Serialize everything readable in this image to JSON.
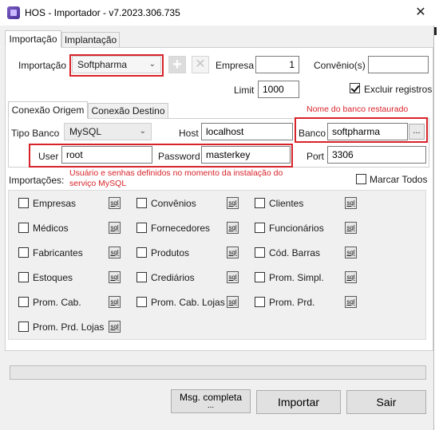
{
  "window": {
    "title": "HOS - Importador - v7.2023.306.735",
    "close_glyph": "✕"
  },
  "tabs": [
    {
      "label": "Importação",
      "active": true
    },
    {
      "label": "Implantação",
      "active": false
    }
  ],
  "import_row": {
    "importacao_label": "Importação",
    "importacao_value": "Softpharma",
    "add_glyph": "+",
    "remove_glyph": "✕",
    "empresa_label": "Empresa",
    "empresa_value": "1",
    "convenio_label": "Convênio(s)",
    "convenio_value": "",
    "limit_label": "Limit",
    "limit_value": "1000",
    "excluir_label": "Excluir registros",
    "excluir_checked": true
  },
  "conn_tabs": [
    {
      "label": "Conexão Origem",
      "active": true
    },
    {
      "label": "Conexão Destino",
      "active": false
    }
  ],
  "notes": {
    "banco_note": "Nome do banco restaurado",
    "user_note_line1": "Usuário e senhas definidos no momento da instalação do",
    "user_note_line2": "serviço MySQL"
  },
  "connection": {
    "tipo_banco_label": "Tipo Banco",
    "tipo_banco_value": "MySQL",
    "host_label": "Host",
    "host_value": "localhost",
    "banco_label": "Banco",
    "banco_value": "softpharma",
    "browse_glyph": "...",
    "user_label": "User",
    "user_value": "root",
    "password_label": "Password",
    "password_value": "masterkey",
    "port_label": "Port",
    "port_value": "3306"
  },
  "importacoes": {
    "label": "Importações:",
    "marcar_todos": "Marcar Todos",
    "sql_label": "sql",
    "items": [
      {
        "label": "Empresas"
      },
      {
        "label": "Convênios"
      },
      {
        "label": "Clientes"
      },
      {
        "label": "Médicos"
      },
      {
        "label": "Fornecedores"
      },
      {
        "label": "Funcionários"
      },
      {
        "label": "Fabricantes"
      },
      {
        "label": "Produtos"
      },
      {
        "label": "Cód. Barras"
      },
      {
        "label": "Estoques"
      },
      {
        "label": "Crediários"
      },
      {
        "label": "Prom. Simpl."
      },
      {
        "label": "Prom. Cab."
      },
      {
        "label": "Prom. Cab. Lojas"
      },
      {
        "label": "Prom. Prd."
      },
      {
        "label": "Prom. Prd. Lojas"
      }
    ]
  },
  "progress": {
    "value": 0
  },
  "buttons": {
    "msg_completa": "Msg. completa",
    "msg_completa_sub": "...",
    "importar": "Importar",
    "sair": "Sair"
  },
  "colors": {
    "annotation_red": "#d8232a",
    "window_bg": "#f0f0f0"
  }
}
